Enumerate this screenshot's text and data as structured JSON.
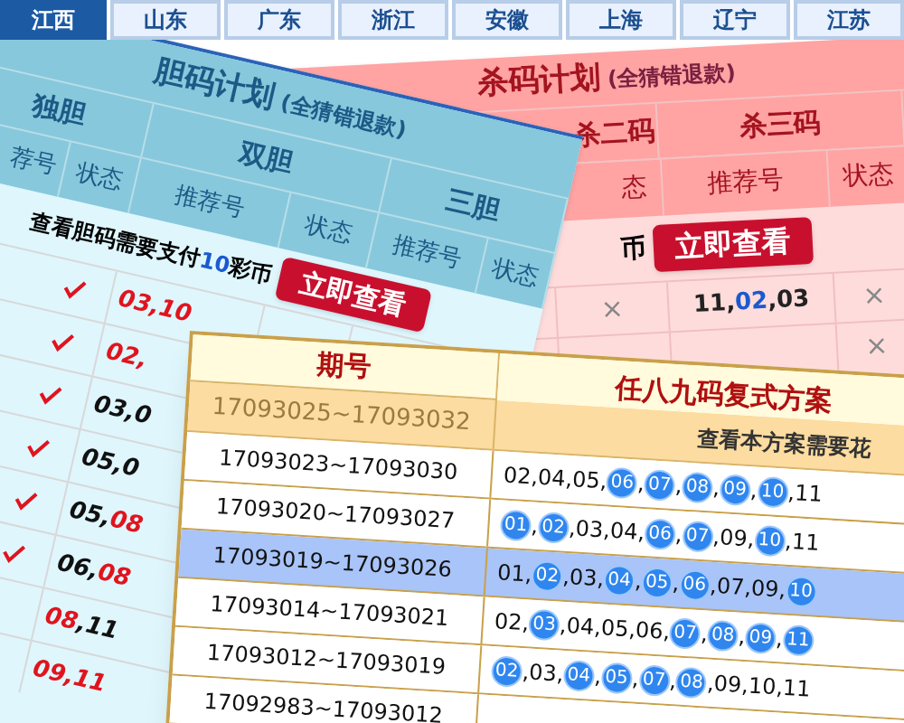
{
  "tabs": [
    {
      "label": "江西",
      "selected": true
    },
    {
      "label": "山东",
      "selected": false
    },
    {
      "label": "广东",
      "selected": false
    },
    {
      "label": "浙江",
      "selected": false
    },
    {
      "label": "安徽",
      "selected": false
    },
    {
      "label": "上海",
      "selected": false
    },
    {
      "label": "辽宁",
      "selected": false
    },
    {
      "label": "江苏",
      "selected": false
    }
  ],
  "kill_plan": {
    "title": "杀码计划",
    "note": "(全猜错退款)",
    "groups": [
      "杀二码",
      "杀三码"
    ],
    "columns": [
      "态",
      "推荐号",
      "状态"
    ],
    "message": "币",
    "button": "立即查看",
    "rows": [
      {
        "mark_left": "×",
        "picks": [
          {
            "text": "11,",
            "hit": false
          },
          {
            "text": "02",
            "hit": true
          },
          {
            "text": ",03",
            "hit": false
          }
        ],
        "mark_right": "×"
      },
      {
        "mark_right": "×"
      }
    ]
  },
  "dan_plan": {
    "title": "胆码计划",
    "note": "(全猜错退款)",
    "groups": [
      "独胆",
      "双胆",
      "三胆"
    ],
    "columns": [
      "荐号",
      "状态",
      "推荐号",
      "状态",
      "推荐号",
      "状态"
    ],
    "message": [
      {
        "text": "查看胆码需要支付",
        "highlight": false
      },
      {
        "text": "10",
        "highlight": true
      },
      {
        "text": "彩币",
        "highlight": false
      }
    ],
    "button": "立即查看",
    "rows": [
      {
        "checked": true,
        "picks": [
          {
            "text": "03,10",
            "hit": true
          }
        ]
      },
      {
        "checked": true,
        "picks": [
          {
            "text": "02,",
            "hit": true
          }
        ]
      },
      {
        "checked": true,
        "picks": [
          {
            "text": "03,0",
            "hit": false
          }
        ]
      },
      {
        "checked": true,
        "picks": [
          {
            "text": "05,0",
            "hit": false
          }
        ]
      },
      {
        "checked": true,
        "picks": [
          {
            "text": "05,",
            "hit": false
          },
          {
            "text": "08",
            "hit": true
          }
        ]
      },
      {
        "checked": true,
        "picks": [
          {
            "text": "06,",
            "hit": false
          },
          {
            "text": "08",
            "hit": true
          }
        ]
      },
      {
        "checked": false,
        "picks": [
          {
            "text": "08",
            "hit": true
          },
          {
            "text": ",11",
            "hit": false
          }
        ]
      },
      {
        "checked": false,
        "picks": [
          {
            "text": "09,11",
            "hit": true
          }
        ]
      }
    ]
  },
  "scheme": {
    "columns": [
      "期号",
      "任八九码复式方案"
    ],
    "separator": ",",
    "promo": {
      "period": "17093025~17093032",
      "message": "查看本方案需要花"
    },
    "rows": [
      {
        "period": "17093023~17093030",
        "selected": false,
        "numbers": [
          {
            "n": "02",
            "hit": false
          },
          {
            "n": "04",
            "hit": false
          },
          {
            "n": "05",
            "hit": false
          },
          {
            "n": "06",
            "hit": true
          },
          {
            "n": "07",
            "hit": true
          },
          {
            "n": "08",
            "hit": true
          },
          {
            "n": "09",
            "hit": true
          },
          {
            "n": "10",
            "hit": true
          },
          {
            "n": "11",
            "hit": false
          }
        ]
      },
      {
        "period": "17093020~17093027",
        "selected": false,
        "numbers": [
          {
            "n": "01",
            "hit": true
          },
          {
            "n": "02",
            "hit": true
          },
          {
            "n": "03",
            "hit": false
          },
          {
            "n": "04",
            "hit": false
          },
          {
            "n": "06",
            "hit": true
          },
          {
            "n": "07",
            "hit": true
          },
          {
            "n": "09",
            "hit": false
          },
          {
            "n": "10",
            "hit": true
          },
          {
            "n": "11",
            "hit": false
          }
        ]
      },
      {
        "period": "17093019~17093026",
        "selected": true,
        "numbers": [
          {
            "n": "01",
            "hit": false
          },
          {
            "n": "02",
            "hit": true
          },
          {
            "n": "03",
            "hit": false
          },
          {
            "n": "04",
            "hit": true
          },
          {
            "n": "05",
            "hit": true
          },
          {
            "n": "06",
            "hit": true
          },
          {
            "n": "07",
            "hit": false
          },
          {
            "n": "09",
            "hit": false
          },
          {
            "n": "10",
            "hit": true
          }
        ]
      },
      {
        "period": "17093014~17093021",
        "selected": false,
        "numbers": [
          {
            "n": "02",
            "hit": false
          },
          {
            "n": "03",
            "hit": true
          },
          {
            "n": "04",
            "hit": false
          },
          {
            "n": "05",
            "hit": false
          },
          {
            "n": "06",
            "hit": false
          },
          {
            "n": "07",
            "hit": true
          },
          {
            "n": "08",
            "hit": true
          },
          {
            "n": "09",
            "hit": true
          },
          {
            "n": "11",
            "hit": true
          }
        ]
      },
      {
        "period": "17093012~17093019",
        "selected": false,
        "numbers": [
          {
            "n": "02",
            "hit": true
          },
          {
            "n": "03",
            "hit": false
          },
          {
            "n": "04",
            "hit": true
          },
          {
            "n": "05",
            "hit": true
          },
          {
            "n": "07",
            "hit": true
          },
          {
            "n": "08",
            "hit": true
          },
          {
            "n": "09",
            "hit": false
          },
          {
            "n": "10",
            "hit": false
          },
          {
            "n": "11",
            "hit": false
          }
        ]
      },
      {
        "period": "17092983~17093012",
        "selected": false
      }
    ]
  }
}
